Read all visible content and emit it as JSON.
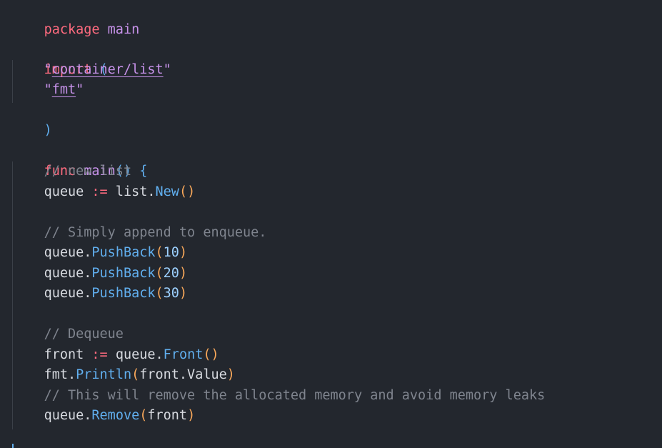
{
  "code": {
    "l1": {
      "kw": "package",
      "name": "main"
    },
    "l3": {
      "kw": "import",
      "paren": "("
    },
    "l4": {
      "q1": "\"",
      "path": "container/list",
      "q2": "\""
    },
    "l5": {
      "q1": "\"",
      "path": "fmt",
      "q2": "\""
    },
    "l6": {
      "paren": ")"
    },
    "l8": {
      "kw": "func",
      "name": "main",
      "parens": "()",
      "brace": "{"
    },
    "l9": {
      "comment": "// new list"
    },
    "l10": {
      "var": "queue",
      "op": ":=",
      "pkg": "list",
      "dot": ".",
      "method": "New",
      "parens": "()"
    },
    "l12": {
      "comment": "// Simply append to enqueue."
    },
    "l13": {
      "var": "queue",
      "dot": ".",
      "method": "PushBack",
      "open": "(",
      "arg": "10",
      "close": ")"
    },
    "l14": {
      "var": "queue",
      "dot": ".",
      "method": "PushBack",
      "open": "(",
      "arg": "20",
      "close": ")"
    },
    "l15": {
      "var": "queue",
      "dot": ".",
      "method": "PushBack",
      "open": "(",
      "arg": "30",
      "close": ")"
    },
    "l17": {
      "comment": "// Dequeue"
    },
    "l18": {
      "var": "front",
      "op": ":=",
      "obj": "queue",
      "dot": ".",
      "method": "Front",
      "parens": "()"
    },
    "l19": {
      "pkg": "fmt",
      "dot": ".",
      "method": "Println",
      "open": "(",
      "arg": "front.Value",
      "close": ")"
    },
    "l20": {
      "comment": "// This will remove the allocated memory and avoid memory leaks"
    },
    "l21": {
      "var": "queue",
      "dot": ".",
      "method": "Remove",
      "open": "(",
      "arg": "front",
      "close": ")"
    },
    "l22": {
      "brace": "}"
    }
  },
  "colors": {
    "background": "#23272e",
    "keyword": "#ff6b7f",
    "identifier": "#c792ea",
    "method": "#61afef",
    "comment": "#7f848e",
    "paren": "#f9a85a"
  }
}
